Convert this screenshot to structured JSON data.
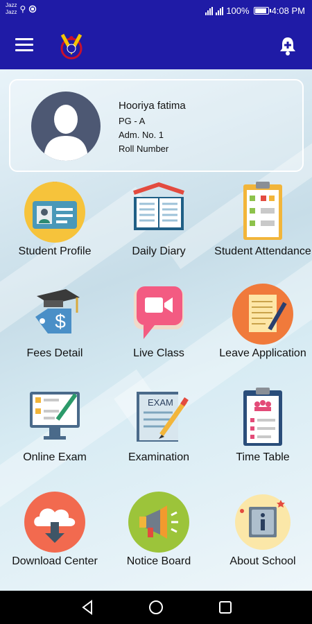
{
  "status_bar": {
    "carrier_1": "Jazz",
    "carrier_2": "Jazz",
    "battery": "100%",
    "time": "4:08 PM"
  },
  "profile": {
    "name": "Hooriya fatima",
    "class": "PG - A",
    "admission": "Adm. No. 1",
    "roll": "Roll Number"
  },
  "menu": [
    {
      "label": "Student Profile",
      "icon": "id-card-icon"
    },
    {
      "label": "Daily Diary",
      "icon": "book-icon"
    },
    {
      "label": "Student Attendance",
      "icon": "clipboard-checklist-icon"
    },
    {
      "label": "Fees Detail",
      "icon": "fees-tag-icon"
    },
    {
      "label": "Live Class",
      "icon": "video-camera-icon"
    },
    {
      "label": "Leave Application",
      "icon": "note-pen-icon"
    },
    {
      "label": "Online Exam",
      "icon": "monitor-checklist-icon"
    },
    {
      "label": "Examination",
      "icon": "exam-paper-icon"
    },
    {
      "label": "Time Table",
      "icon": "clipboard-people-icon"
    },
    {
      "label": "Download Center",
      "icon": "cloud-download-icon"
    },
    {
      "label": "Notice Board",
      "icon": "megaphone-icon"
    },
    {
      "label": "About School",
      "icon": "info-icon"
    }
  ],
  "colors": {
    "primary": "#1f1ba6",
    "nav_bar": "#000000"
  }
}
